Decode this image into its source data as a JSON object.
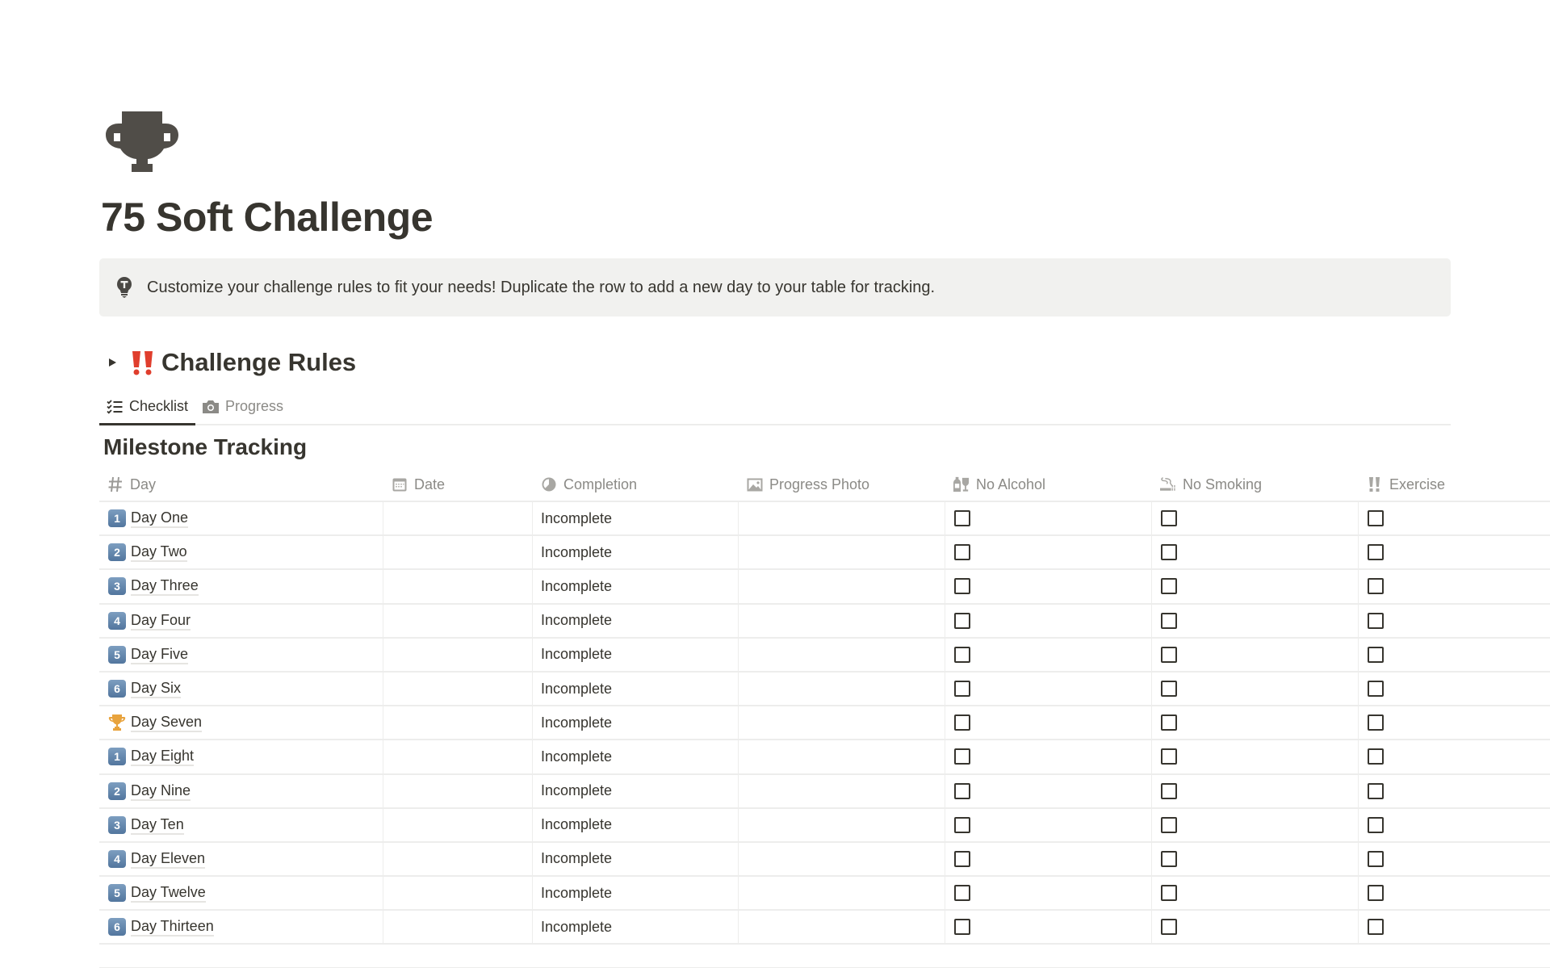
{
  "page": {
    "icon": "trophy-icon",
    "title": "75 Soft Challenge"
  },
  "callout": {
    "icon": "lightbulb-icon",
    "text": "Customize your challenge rules to fit your needs! Duplicate the row to add a new day to your table for tracking."
  },
  "toggle": {
    "emoji": "‼️",
    "title": "Challenge Rules",
    "collapsed": true
  },
  "tabs": [
    {
      "label": "Checklist",
      "icon": "checklist-icon",
      "active": true
    },
    {
      "label": "Progress",
      "icon": "camera-icon",
      "active": false
    }
  ],
  "database": {
    "title": "Milestone Tracking",
    "columns": [
      {
        "label": "Day",
        "icon": "hash-icon"
      },
      {
        "label": "Date",
        "icon": "calendar-icon"
      },
      {
        "label": "Completion",
        "icon": "formula-circle-icon"
      },
      {
        "label": "Progress Photo",
        "icon": "image-icon"
      },
      {
        "label": "No Alcohol",
        "icon": "bottle-glass-icon"
      },
      {
        "label": "No Smoking",
        "icon": "smoking-icon"
      },
      {
        "label": "Exercise",
        "icon": "double-exclamation-icon"
      }
    ],
    "rows": [
      {
        "emoji": "1",
        "name": "Day One",
        "date": "",
        "completion": "Incomplete",
        "no_alcohol": false,
        "no_smoking": false,
        "exercise": false
      },
      {
        "emoji": "2",
        "name": "Day Two",
        "date": "",
        "completion": "Incomplete",
        "no_alcohol": false,
        "no_smoking": false,
        "exercise": false
      },
      {
        "emoji": "3",
        "name": "Day Three",
        "date": "",
        "completion": "Incomplete",
        "no_alcohol": false,
        "no_smoking": false,
        "exercise": false
      },
      {
        "emoji": "4",
        "name": "Day Four",
        "date": "",
        "completion": "Incomplete",
        "no_alcohol": false,
        "no_smoking": false,
        "exercise": false
      },
      {
        "emoji": "5",
        "name": "Day Five",
        "date": "",
        "completion": "Incomplete",
        "no_alcohol": false,
        "no_smoking": false,
        "exercise": false
      },
      {
        "emoji": "6",
        "name": "Day Six",
        "date": "",
        "completion": "Incomplete",
        "no_alcohol": false,
        "no_smoking": false,
        "exercise": false
      },
      {
        "emoji": "trophy",
        "name": "Day Seven",
        "date": "",
        "completion": "Incomplete",
        "no_alcohol": false,
        "no_smoking": false,
        "exercise": false
      },
      {
        "emoji": "1",
        "name": "Day Eight",
        "date": "",
        "completion": "Incomplete",
        "no_alcohol": false,
        "no_smoking": false,
        "exercise": false
      },
      {
        "emoji": "2",
        "name": "Day Nine",
        "date": "",
        "completion": "Incomplete",
        "no_alcohol": false,
        "no_smoking": false,
        "exercise": false
      },
      {
        "emoji": "3",
        "name": "Day Ten",
        "date": "",
        "completion": "Incomplete",
        "no_alcohol": false,
        "no_smoking": false,
        "exercise": false
      },
      {
        "emoji": "4",
        "name": "Day Eleven",
        "date": "",
        "completion": "Incomplete",
        "no_alcohol": false,
        "no_smoking": false,
        "exercise": false
      },
      {
        "emoji": "5",
        "name": "Day Twelve",
        "date": "",
        "completion": "Incomplete",
        "no_alcohol": false,
        "no_smoking": false,
        "exercise": false
      },
      {
        "emoji": "6",
        "name": "Day Thirteen",
        "date": "",
        "completion": "Incomplete",
        "no_alcohol": false,
        "no_smoking": false,
        "exercise": false
      }
    ]
  },
  "colors": {
    "text": "#37352f",
    "muted": "#8b8a86",
    "callout_bg": "#f1f1ef",
    "divider": "#ededec",
    "accent_red": "#e03e2d"
  }
}
